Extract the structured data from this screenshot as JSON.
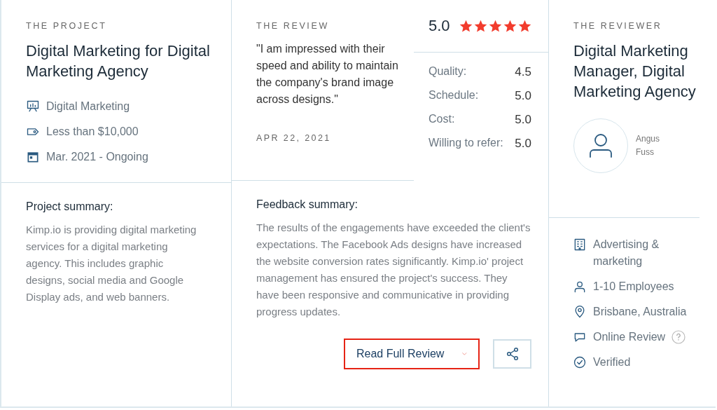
{
  "project": {
    "eyebrow": "THE PROJECT",
    "title": "Digital Marketing for Digital Marketing Agency",
    "details": [
      {
        "kind": "service",
        "text": "Digital Marketing"
      },
      {
        "kind": "budget",
        "text": "Less than $10,000"
      },
      {
        "kind": "dates",
        "text": "Mar. 2021 - Ongoing"
      }
    ],
    "summary_heading": "Project summary:",
    "summary": "Kimp.io is providing digital marketing services for a digital marketing agency. This includes graphic designs, social media and Google Display ads, and web banners."
  },
  "review": {
    "eyebrow": "THE REVIEW",
    "quote": "\"I am impressed with their speed and ability to maintain the company's brand image across designs.\"",
    "date": "APR 22, 2021",
    "summary_heading": "Feedback summary:",
    "summary": "The results of the engagements have exceeded the client's expectations. The Facebook Ads designs have increased the website conversion rates significantly. Kimp.io' project management has ensured the project's success. They have been responsive and communicative in providing progress updates.",
    "read_button": "Read Full Review"
  },
  "rating": {
    "score": "5.0",
    "stars": 5,
    "breakdown": [
      {
        "label": "Quality:",
        "value": "4.5"
      },
      {
        "label": "Schedule:",
        "value": "5.0"
      },
      {
        "label": "Cost:",
        "value": "5.0"
      },
      {
        "label": "Willing to refer:",
        "value": "5.0"
      }
    ]
  },
  "reviewer": {
    "eyebrow": "THE REVIEWER",
    "title": "Digital Marketing Manager, Digital Marketing Agency",
    "name": "Angus Fuss",
    "details": [
      {
        "kind": "industry",
        "text": "Advertising & marketing",
        "help": false
      },
      {
        "kind": "size",
        "text": "1-10 Employees",
        "help": false
      },
      {
        "kind": "location",
        "text": "Brisbane, Australia",
        "help": false
      },
      {
        "kind": "review-type",
        "text": "Online Review",
        "help": true
      },
      {
        "kind": "verified",
        "text": "Verified",
        "help": false
      }
    ]
  }
}
